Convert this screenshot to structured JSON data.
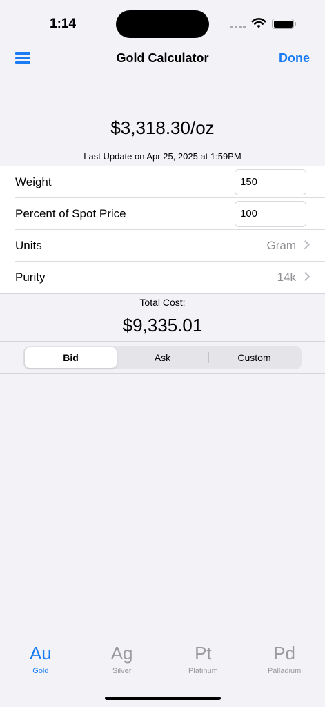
{
  "status": {
    "time": "1:14"
  },
  "nav": {
    "title": "Gold Calculator",
    "done_label": "Done"
  },
  "price": {
    "spot": "$3,318.30/oz",
    "last_update": "Last Update on Apr 25, 2025 at 1:59PM"
  },
  "form": {
    "weight": {
      "label": "Weight",
      "value": "150"
    },
    "percent": {
      "label": "Percent of Spot Price",
      "value": "100"
    },
    "units": {
      "label": "Units",
      "value": "Gram"
    },
    "purity": {
      "label": "Purity",
      "value": "14k"
    }
  },
  "total": {
    "label": "Total Cost:",
    "value": "$9,335.01"
  },
  "segments": [
    {
      "label": "Bid",
      "selected": true
    },
    {
      "label": "Ask"
    },
    {
      "label": "Custom"
    }
  ],
  "tabs": [
    {
      "symbol": "Au",
      "label": "Gold",
      "active": true
    },
    {
      "symbol": "Ag",
      "label": "Silver"
    },
    {
      "symbol": "Pt",
      "label": "Platinum"
    },
    {
      "symbol": "Pd",
      "label": "Palladium"
    }
  ],
  "colors": {
    "accent": "#1a7cf5",
    "background": "#f2f2f7",
    "inactive": "#9a9a9f"
  }
}
